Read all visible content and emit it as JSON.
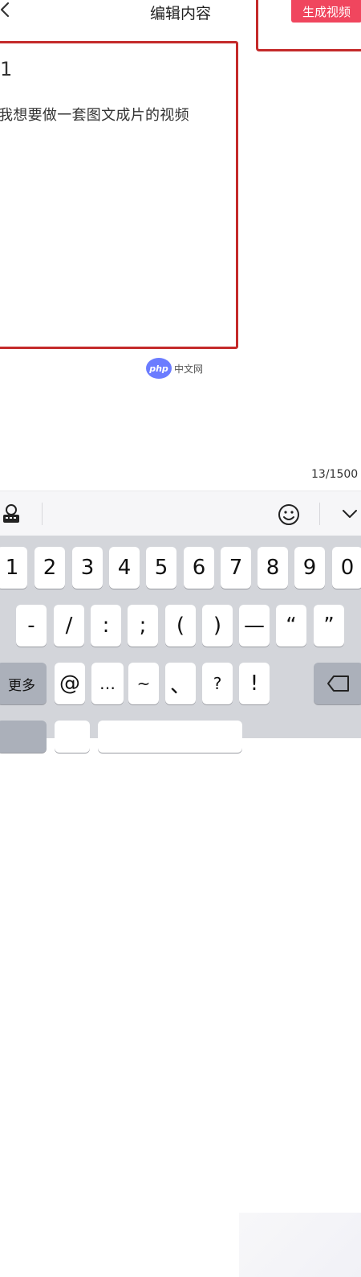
{
  "header": {
    "title": "编辑内容",
    "generate_label": "生成视频"
  },
  "editor": {
    "number": "1",
    "content": "我想要做一套图文成片的视频",
    "char_count": "13/1500"
  },
  "watermark": {
    "logo": "php",
    "text": "中文网"
  },
  "toolbar": {
    "icons": [
      "voice-keyboard-icon",
      "emoji-icon",
      "collapse-chevron-icon"
    ]
  },
  "keyboard": {
    "row1": [
      "1",
      "2",
      "3",
      "4",
      "5",
      "6",
      "7",
      "8",
      "9",
      "0"
    ],
    "row2": [
      "-",
      "/",
      ":",
      ";",
      "(",
      ")",
      "—",
      "“",
      "”"
    ],
    "row3": [
      "更多",
      "@",
      "…",
      "~",
      "、",
      "?",
      "!"
    ]
  },
  "colors": {
    "accent": "#f0465e",
    "annotation": "#c42a2a",
    "keyboard_bg": "#d3d5da",
    "key_bg": "#ffffff",
    "func_key_bg": "#abb0ba"
  }
}
